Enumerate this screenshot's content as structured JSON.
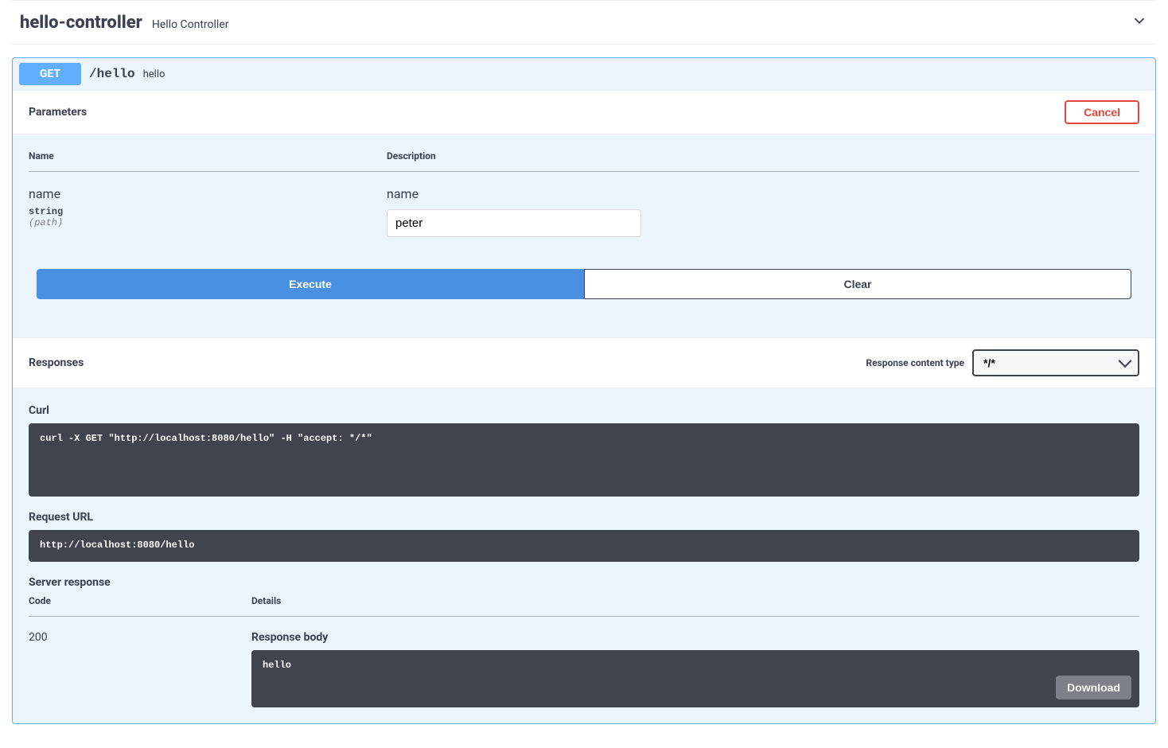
{
  "tag": {
    "name": "hello-controller",
    "description": "Hello Controller"
  },
  "operation": {
    "method": "GET",
    "path": "/hello",
    "summary": "hello"
  },
  "parameters_section": {
    "title": "Parameters",
    "cancel_label": "Cancel",
    "name_header": "Name",
    "desc_header": "Description",
    "param": {
      "name": "name",
      "type": "string",
      "in": "(path)",
      "desc": "name",
      "value": "peter"
    },
    "execute_label": "Execute",
    "clear_label": "Clear"
  },
  "responses_section": {
    "title": "Responses",
    "content_type_label": "Response content type",
    "content_type_value": "*/*",
    "curl_label": "Curl",
    "curl_value": "curl -X GET \"http://localhost:8080/hello\" -H \"accept: */*\"",
    "request_url_label": "Request URL",
    "request_url_value": "http://localhost:8080/hello",
    "server_response_label": "Server response",
    "code_header": "Code",
    "details_header": "Details",
    "code": "200",
    "response_body_label": "Response body",
    "response_body_value": "hello",
    "download_label": "Download"
  }
}
